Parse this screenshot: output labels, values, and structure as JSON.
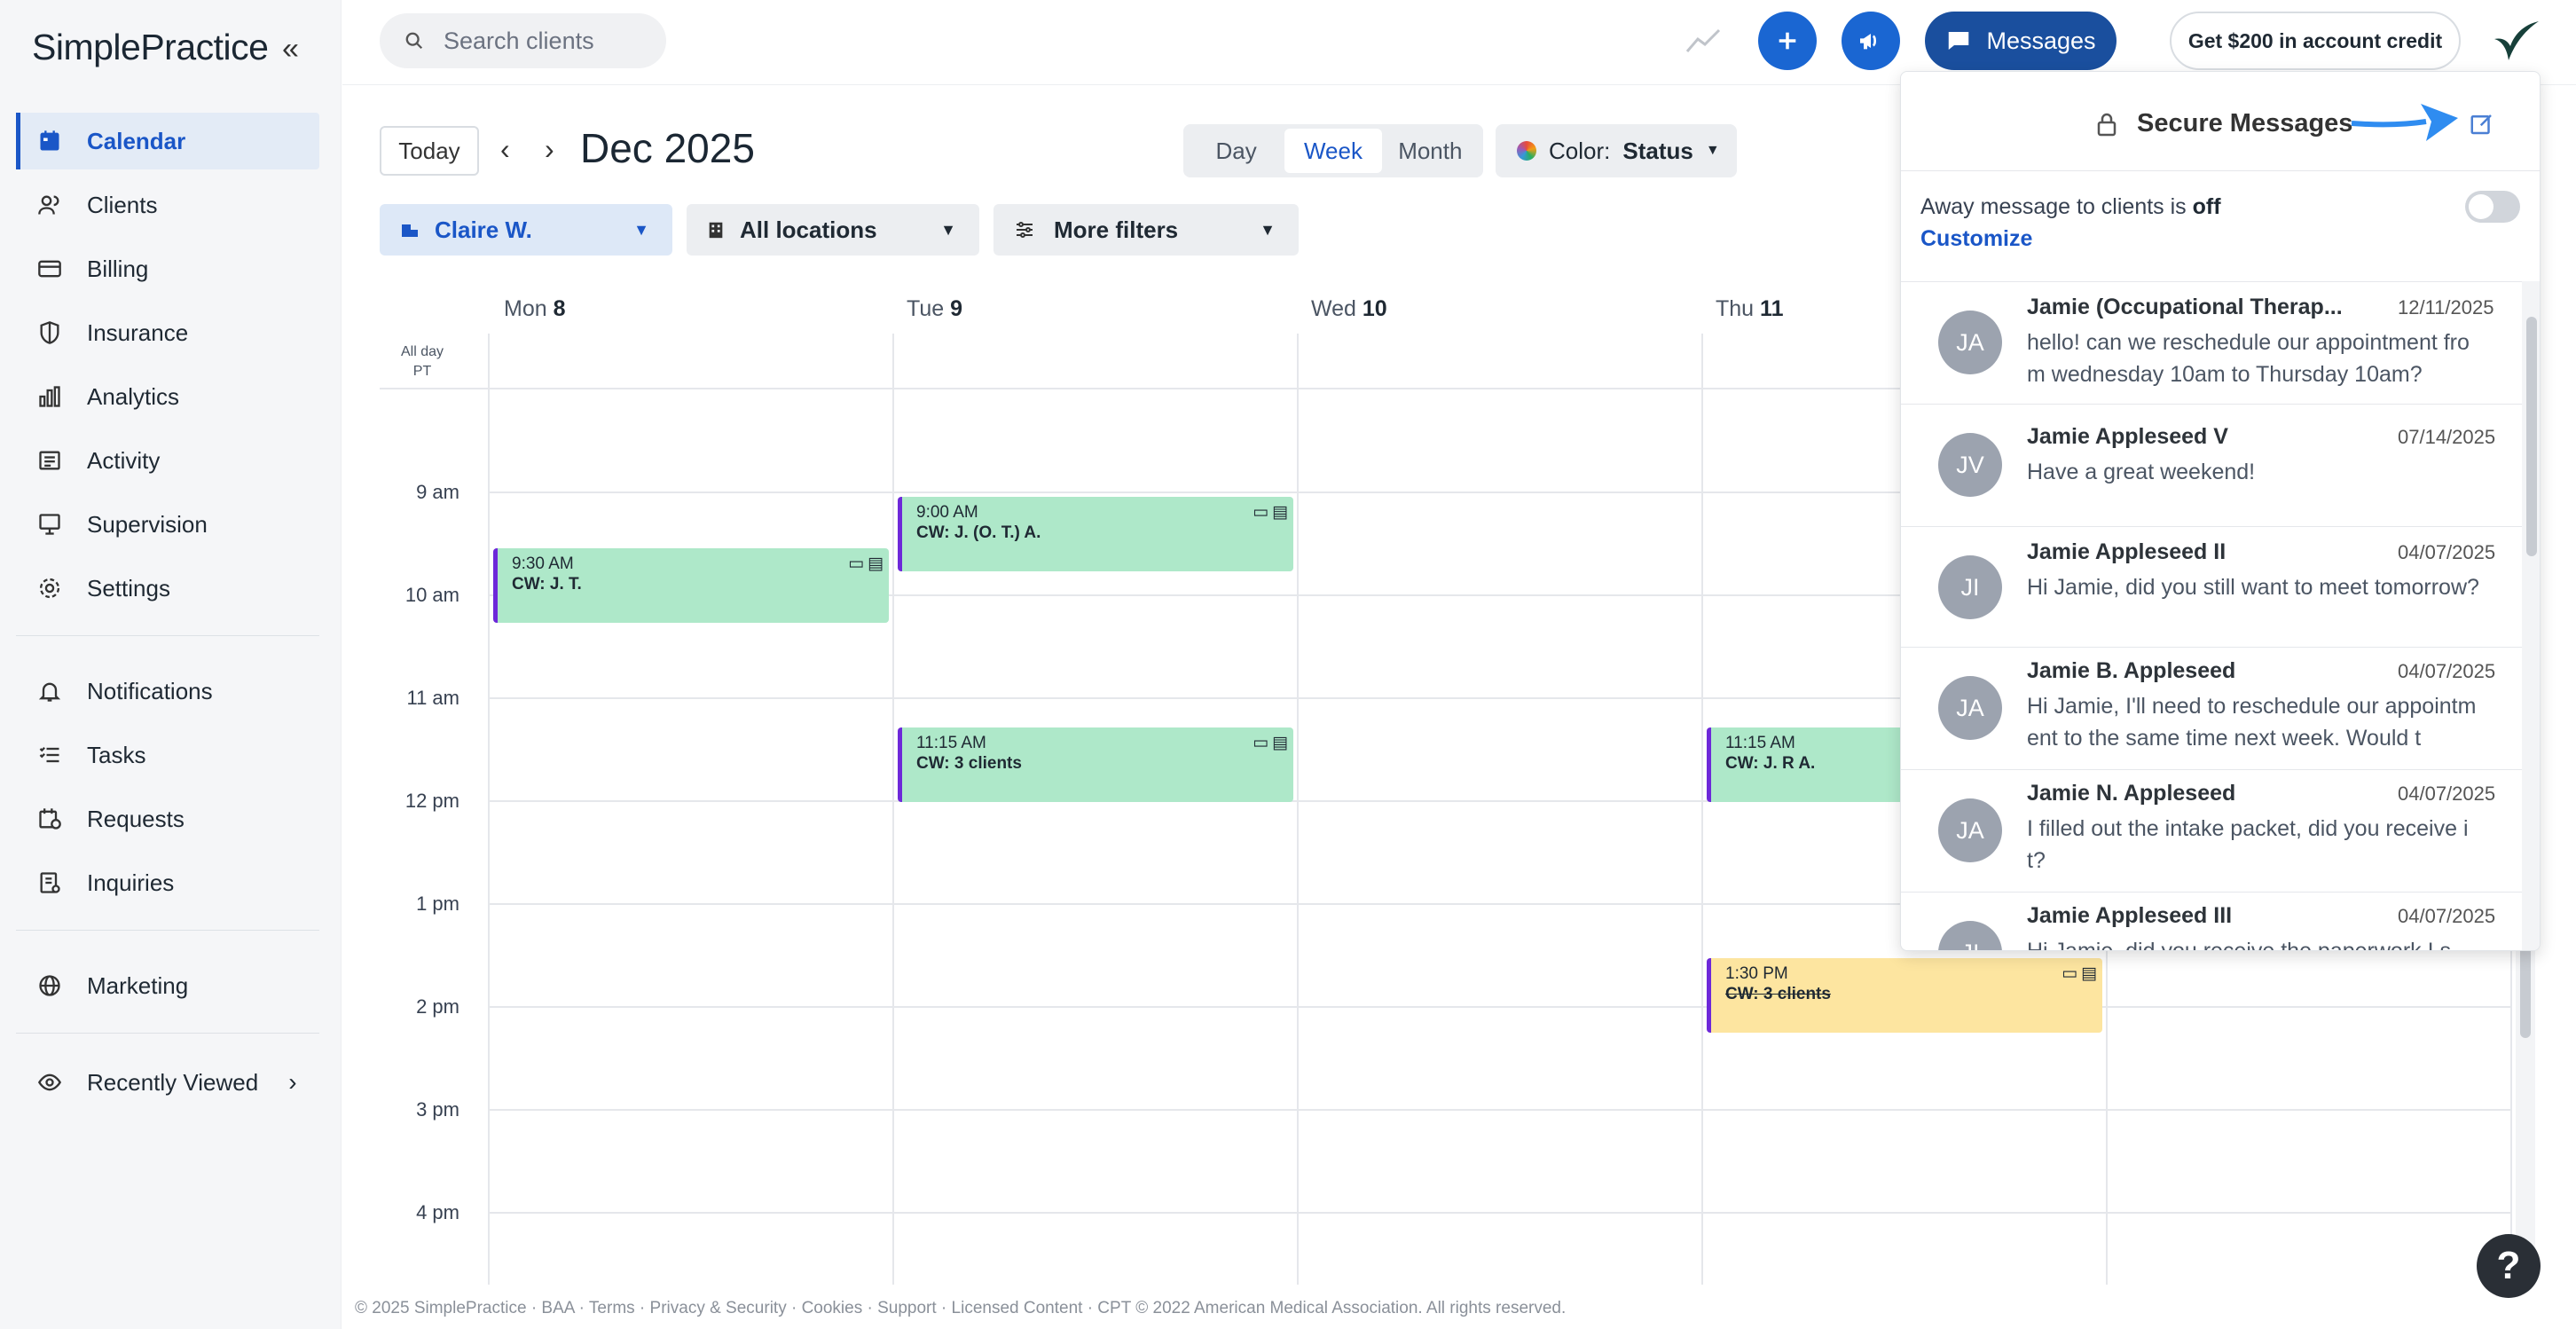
{
  "app": {
    "logo": "SimplePractice"
  },
  "sidebar": {
    "items": [
      {
        "label": "Calendar",
        "icon": "calendar-icon"
      },
      {
        "label": "Clients",
        "icon": "clients-icon"
      },
      {
        "label": "Billing",
        "icon": "credit-card-icon"
      },
      {
        "label": "Insurance",
        "icon": "shield-icon"
      },
      {
        "label": "Analytics",
        "icon": "bar-chart-icon"
      },
      {
        "label": "Activity",
        "icon": "list-icon"
      },
      {
        "label": "Supervision",
        "icon": "supervision-icon"
      },
      {
        "label": "Settings",
        "icon": "gear-icon"
      },
      {
        "label": "Notifications",
        "icon": "bell-icon"
      },
      {
        "label": "Tasks",
        "icon": "tasks-icon"
      },
      {
        "label": "Requests",
        "icon": "requests-icon"
      },
      {
        "label": "Inquiries",
        "icon": "inquiries-icon"
      },
      {
        "label": "Marketing",
        "icon": "globe-icon"
      },
      {
        "label": "Recently Viewed",
        "icon": "eye-icon"
      }
    ]
  },
  "topbar": {
    "search_placeholder": "Search clients",
    "messages_label": "Messages",
    "credit_label": "Get $200 in account credit"
  },
  "toolbar": {
    "today": "Today",
    "month_title": "Dec 2025",
    "views": [
      "Day",
      "Week",
      "Month"
    ],
    "active_view": "Week",
    "color_prefix": "Color:",
    "color_value": "Status"
  },
  "filters": {
    "clinician": "Claire W.",
    "locations": "All locations",
    "more": "More filters"
  },
  "calendar": {
    "days": [
      {
        "name": "Mon",
        "num": "8"
      },
      {
        "name": "Tue",
        "num": "9"
      },
      {
        "name": "Wed",
        "num": "10"
      },
      {
        "name": "Thu",
        "num": "11"
      }
    ],
    "allday_label": "All day",
    "tz_label": "PT",
    "hours": [
      "9 am",
      "10 am",
      "11 am",
      "12 pm",
      "1 pm",
      "2 pm",
      "3 pm",
      "4 pm"
    ],
    "events": [
      {
        "time": "9:30 AM",
        "title": "CW: J. T.",
        "color": "#aee8c9"
      },
      {
        "time": "9:00 AM",
        "title": "CW: J. (O. T.) A.",
        "color": "#aee8c9"
      },
      {
        "time": "11:15 AM",
        "title": "CW: 3 clients",
        "color": "#aee8c9"
      },
      {
        "time": "11:15 AM",
        "title": "CW: J. R A.",
        "color": "#aee8c9"
      },
      {
        "time": "1:30 PM",
        "title": "CW: 3 clients",
        "color": "#fde5a0",
        "cancelled": true
      }
    ]
  },
  "messages_panel": {
    "title": "Secure Messages",
    "away_prefix": "Away message to clients is",
    "away_state": "off",
    "customize": "Customize",
    "threads": [
      {
        "initials": "JA",
        "name": "Jamie (Occupational Therap...",
        "date": "12/11/2025",
        "body": "hello! can we reschedule our appointment from wednesday 10am to Thursday 10am?"
      },
      {
        "initials": "JV",
        "name": "Jamie Appleseed V",
        "date": "07/14/2025",
        "body": "Have a great weekend!"
      },
      {
        "initials": "JI",
        "name": "Jamie Appleseed II",
        "date": "04/07/2025",
        "body": "Hi Jamie, did you still want to meet tomorrow?"
      },
      {
        "initials": "JA",
        "name": "Jamie B. Appleseed",
        "date": "04/07/2025",
        "body": "Hi Jamie, I'll need to reschedule our appointment to the same time next week. Would t"
      },
      {
        "initials": "JA",
        "name": "Jamie N. Appleseed",
        "date": "04/07/2025",
        "body": "I filled out the intake packet, did you receive it?"
      },
      {
        "initials": "JI",
        "name": "Jamie Appleseed III",
        "date": "04/07/2025",
        "body": "Hi Jamie, did you receive the paperwork I s"
      }
    ]
  },
  "footer": {
    "text": "© 2025 SimplePractice · BAA · Terms · Privacy & Security · Cookies · Support · Licensed Content · CPT © 2022 American Medical Association. All rights reserved."
  },
  "help": {
    "label": "?"
  },
  "colors": {
    "accent": "#1a56c7",
    "messages_btn": "#1a4f9e",
    "event_green": "#aee8c9",
    "event_yellow": "#fde5a0",
    "event_stripe": "#6d28d9",
    "arrow": "#2f8cf0"
  }
}
